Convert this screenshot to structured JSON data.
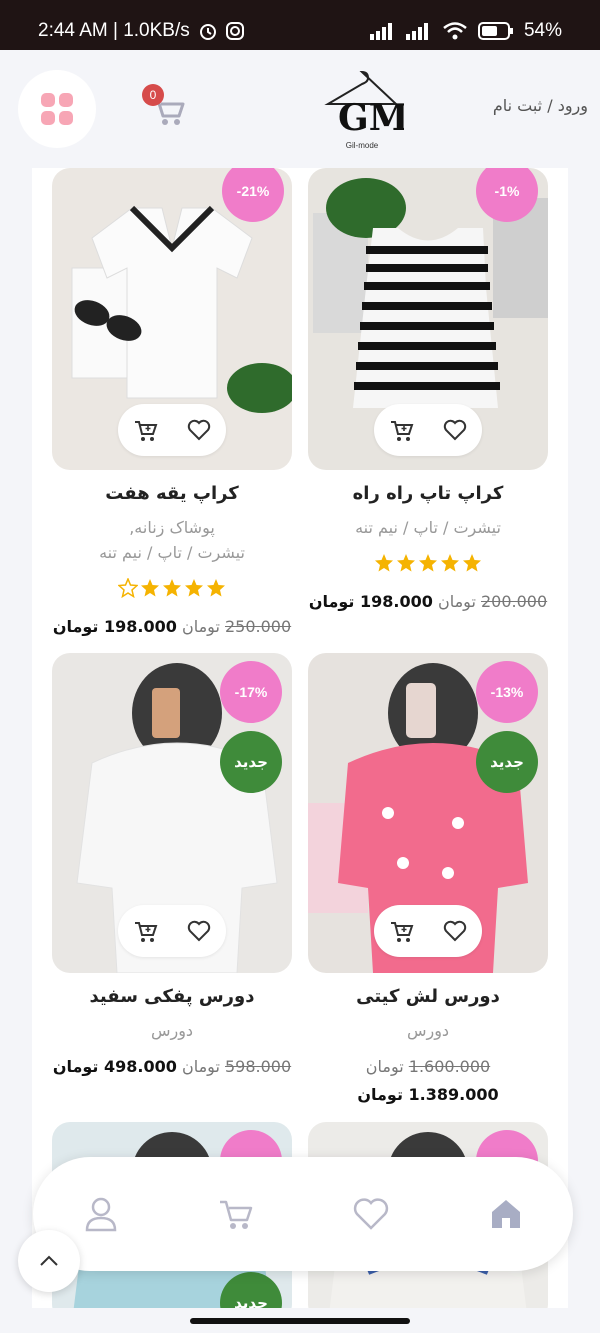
{
  "status_bar": {
    "time_speed": "2:44 AM | 1.0KB/s",
    "battery": "54%"
  },
  "header": {
    "cart_count": "0",
    "logo_text": "Gil-mode",
    "auth_links": "ورود / ثبت نام"
  },
  "products": [
    {
      "title": "کراپ یقه هفت",
      "categories_line1": "پوشاک زنانه,",
      "categories_line2": "تیشرت / تاپ / نیم تنه",
      "discount": "-21%",
      "rating": 4.5,
      "old_price": "250.000",
      "old_currency": "تومان",
      "new_price": "198.000 تومان"
    },
    {
      "title": "کراپ تاپ راه راه",
      "categories_line1": "تیشرت / تاپ / نیم تنه",
      "discount": "-1%",
      "rating": 5,
      "old_price": "200.000",
      "old_currency": "تومان",
      "new_price": "198.000 تومان"
    },
    {
      "title": "دورس پفکی سفید",
      "categories_line1": "دورس",
      "discount": "-17%",
      "new_badge": "جدید",
      "old_price": "598.000",
      "old_currency": "تومان",
      "new_price": "498.000 تومان"
    },
    {
      "title": "دورس لش کیتی",
      "categories_line1": "دورس",
      "discount": "-13%",
      "new_badge": "جدید",
      "old_price": "1.600.000",
      "old_currency": "تومان",
      "new_price": "1.389.000 تومان"
    },
    {
      "new_badge": "جدید"
    }
  ],
  "colors": {
    "discount_pink": "#f07cc9",
    "new_green": "#3f8b3a",
    "star_gold": "#f5b301",
    "badge_red": "#d64b4b",
    "nav_icon": "#b8b8c8"
  },
  "bottom_nav": [
    "user-icon",
    "cart-icon",
    "heart-icon",
    "home-icon"
  ]
}
